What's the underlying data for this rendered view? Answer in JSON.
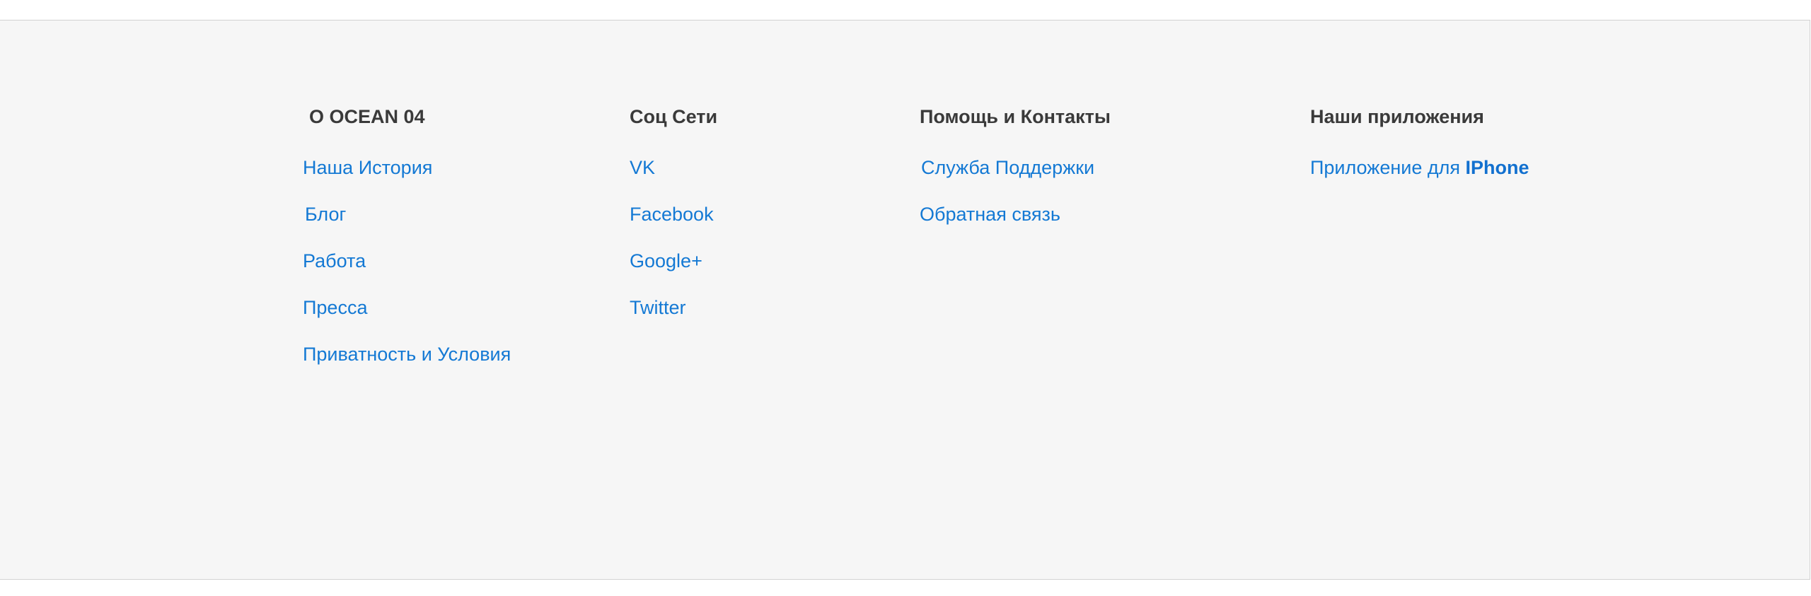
{
  "footer": {
    "about": {
      "title": "О OCEAN 04",
      "links": [
        "Наша История",
        "Блог",
        "Работа",
        "Пресса",
        "Приватность и Условия"
      ]
    },
    "social": {
      "title": "Соц Сети",
      "links": [
        "VK",
        "Facebook",
        "Google+",
        "Twitter"
      ]
    },
    "help": {
      "title": "Помощь и Контакты",
      "links": [
        "Служба Поддержки",
        "Обратная связь"
      ]
    },
    "apps": {
      "title": "Наши приложения",
      "iphone_prefix": "Приложение для ",
      "iphone_strong": "IPhone"
    }
  },
  "colors": {
    "link": "#1479d4",
    "heading": "#3a3a3a",
    "background": "#f6f6f6"
  }
}
